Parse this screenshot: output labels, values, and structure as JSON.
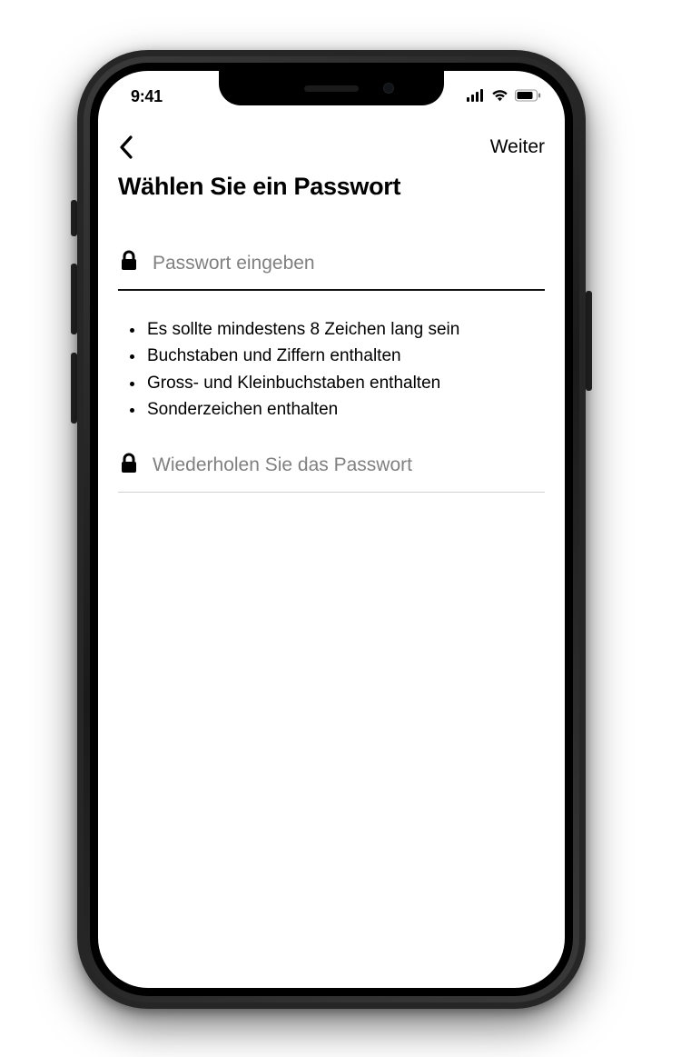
{
  "statusbar": {
    "time": "9:41"
  },
  "nav": {
    "next_label": "Weiter"
  },
  "page": {
    "title": "Wählen Sie ein Passwort"
  },
  "fields": {
    "password_placeholder": "Passwort eingeben",
    "repeat_placeholder": "Wiederholen Sie das Passwort"
  },
  "rules": {
    "r0": "Es sollte mindestens 8 Zeichen lang sein",
    "r1": "Buchstaben und Ziffern enthalten",
    "r2": "Gross- und Kleinbuchstaben enthalten",
    "r3": "Sonderzeichen enthalten"
  }
}
